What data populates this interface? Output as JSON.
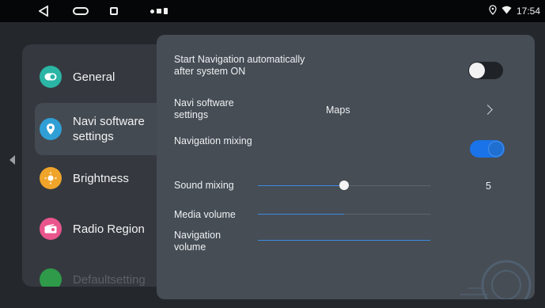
{
  "status_bar": {
    "time": "17:54",
    "location_icon": "location-pin-icon",
    "wifi_icon": "wifi-icon"
  },
  "sidebar": {
    "items": [
      {
        "label": "General",
        "icon": "toggle-icon",
        "color": "#2bb5a5"
      },
      {
        "label": "Navi software settings",
        "icon": "location-pin-icon",
        "color": "#2f9fd6"
      },
      {
        "label": "Brightness",
        "icon": "sun-icon",
        "color": "#f0a52a"
      },
      {
        "label": "Radio Region",
        "icon": "radio-icon",
        "color": "#e9558c"
      },
      {
        "label": "Defaultsetting",
        "icon": "reset-icon",
        "color": "#2e9a4a"
      }
    ]
  },
  "panel": {
    "start_nav": {
      "label": "Start Navigation automatically after system ON",
      "state": "off"
    },
    "navi_software": {
      "label": "Navi software settings",
      "value": "Maps"
    },
    "nav_mixing": {
      "label": "Navigation mixing",
      "state": "on"
    },
    "sound_mixing": {
      "label": "Sound mixing",
      "value": "5",
      "level": 0.5
    },
    "media_volume": {
      "label": "Media volume",
      "level": 0.5
    },
    "navigation_volume": {
      "label": "Navigation volume",
      "level": 1.0
    }
  },
  "colors": {
    "accent": "#1a73e8",
    "panel_bg": "#464d55",
    "sidebar_bg": "#35393f"
  }
}
